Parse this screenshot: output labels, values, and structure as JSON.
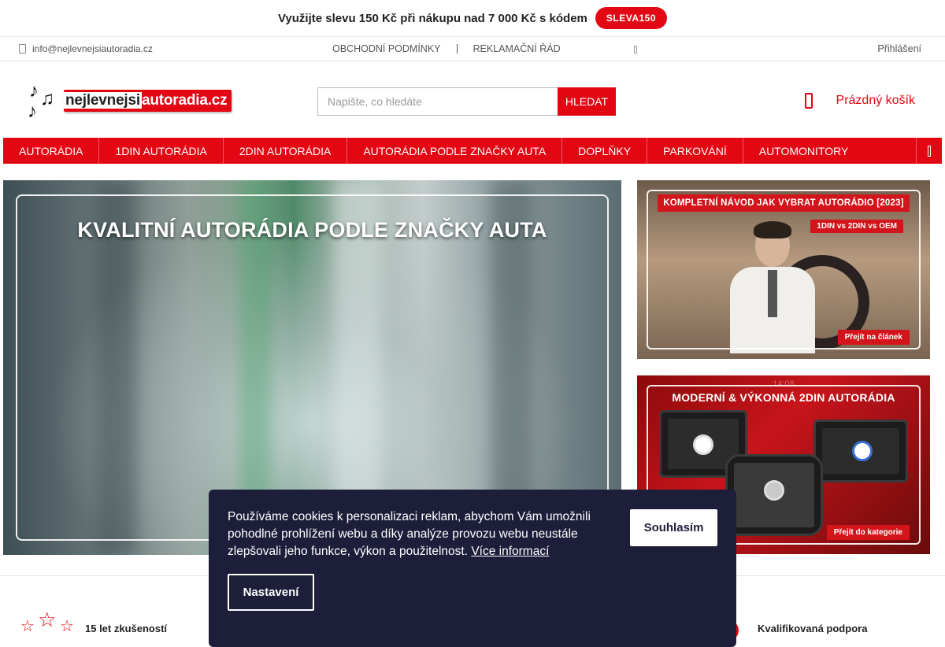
{
  "promo": {
    "text": "Využijte slevu 150 Kč při nákupu nad 7 000 Kč s kódem",
    "code": "SLEVA150"
  },
  "toplinks": {
    "email": "info@nejlevnejsiautoradia.cz",
    "links": [
      "OBCHODNÍ PODMÍNKY",
      "REKLAMAČNÍ ŘÁD"
    ],
    "login": "Přihlášení"
  },
  "header": {
    "logo": {
      "part1": "nejlevnejsi",
      "part2": "autoradia",
      "part3": ".cz"
    },
    "search": {
      "placeholder": "Napište, co hledáte",
      "button": "HLEDAT"
    },
    "cart": {
      "label": "Prázdný košík"
    }
  },
  "nav": {
    "items": [
      "AUTORÁDIA",
      "1DIN AUTORÁDIA",
      "2DIN AUTORÁDIA",
      "AUTORÁDIA PODLE ZNAČKY AUTA",
      "DOPLŇKY",
      "PARKOVÁNÍ",
      "AUTOMONITORY"
    ]
  },
  "hero": {
    "main_title": "KVALITNÍ AUTORÁDIA PODLE ZNAČKY AUTA",
    "banner1": {
      "title": "KOMPLETNÍ NÁVOD JAK VYBRAT AUTORÁDIO [2023]",
      "subtitle": "1DIN vs 2DIN vs OEM",
      "button": "Přejít na článek"
    },
    "banner2": {
      "clock": "14:08",
      "title": "MODERNÍ & VÝKONNÁ 2DIN AUTORÁDIA",
      "button": "Přejít do kategorie"
    }
  },
  "usp": {
    "item1": "15 let zkušeností",
    "item2": "Kvalifikovaná podpora"
  },
  "cookie": {
    "text": "Používáme cookies k personalizaci reklam, abychom Vám umožnili pohodlné prohlížení webu a díky analýze provozu webu neustále zlepšovali jeho funkce, výkon a použitelnost.",
    "link": "Více informací",
    "accept": "Souhlasím",
    "settings": "Nastavení"
  },
  "colors": {
    "brand": "#e30613",
    "cookie_bg": "#1d1e3a"
  }
}
